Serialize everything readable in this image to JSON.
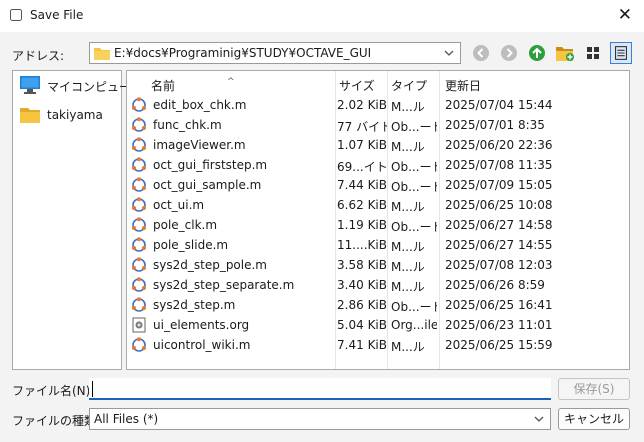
{
  "window": {
    "title": "Save File",
    "close_glyph": "✕"
  },
  "address": {
    "label": "アドレス:",
    "path": "E:¥docs¥Programinig¥STUDY¥OCTAVE_GUI"
  },
  "toolbar": {
    "buttons": [
      "back-icon",
      "forward-icon",
      "parent-folder-icon",
      "new-folder-icon",
      "icon-view-icon",
      "detail-view-icon"
    ]
  },
  "sidebar": {
    "items": [
      {
        "label": "マイコンピュータ",
        "icon": "computer-icon"
      },
      {
        "label": "takiyama",
        "icon": "folder-icon"
      }
    ]
  },
  "file_list": {
    "columns": [
      "名前",
      "サイズ",
      "タイプ",
      "更新日"
    ],
    "rows": [
      {
        "name": "edit_box_chk.m",
        "size": "2.02 KiB",
        "type": "M...ル",
        "date": "2025/07/04 15:44",
        "icon": "octave-file-icon"
      },
      {
        "name": "func_chk.m",
        "size": "77 バイト",
        "type": "Ob...ード",
        "date": "2025/07/01 8:35",
        "icon": "octave-file-icon"
      },
      {
        "name": "imageViewer.m",
        "size": "1.07 KiB",
        "type": "M...ル",
        "date": "2025/06/20 22:36",
        "icon": "octave-file-icon"
      },
      {
        "name": "oct_gui_firststep.m",
        "size": "69...イト",
        "type": "Ob...ード",
        "date": "2025/07/08 11:35",
        "icon": "octave-file-icon"
      },
      {
        "name": "oct_gui_sample.m",
        "size": "7.44 KiB",
        "type": "Ob...ード",
        "date": "2025/07/09 15:05",
        "icon": "octave-file-icon"
      },
      {
        "name": "oct_ui.m",
        "size": "6.62 KiB",
        "type": "M...ル",
        "date": "2025/06/25 10:08",
        "icon": "octave-file-icon"
      },
      {
        "name": "pole_clk.m",
        "size": "1.19 KiB",
        "type": "Ob...ード",
        "date": "2025/06/27 14:58",
        "icon": "octave-file-icon"
      },
      {
        "name": "pole_slide.m",
        "size": "11....KiB",
        "type": "M...ル",
        "date": "2025/06/27 14:55",
        "icon": "octave-file-icon"
      },
      {
        "name": "sys2d_step_pole.m",
        "size": "3.58 KiB",
        "type": "M...ル",
        "date": "2025/07/08 12:03",
        "icon": "octave-file-icon"
      },
      {
        "name": "sys2d_step_separate.m",
        "size": "3.40 KiB",
        "type": "M...ル",
        "date": "2025/06/26 8:59",
        "icon": "octave-file-icon"
      },
      {
        "name": "sys2d_step.m",
        "size": "2.86 KiB",
        "type": "Ob...ード",
        "date": "2025/06/25 16:41",
        "icon": "octave-file-icon"
      },
      {
        "name": "ui_elements.org",
        "size": "5.04 KiB",
        "type": "Org...ile",
        "date": "2025/06/23 11:01",
        "icon": "org-file-icon"
      },
      {
        "name": "uicontrol_wiki.m",
        "size": "7.41 KiB",
        "type": "M...ル",
        "date": "2025/06/25 15:59",
        "icon": "octave-file-icon"
      }
    ]
  },
  "filename": {
    "label": "ファイル名(N):",
    "value": "",
    "placeholder": ""
  },
  "filetype": {
    "label": "ファイルの種類:",
    "value": "All Files (*)"
  },
  "buttons": {
    "save": "保存(S)",
    "cancel": "キャンセル"
  },
  "colors": {
    "accent": "#1f5fbf",
    "folder": "#f5c542",
    "octave_orange": "#e8792d",
    "octave_blue": "#3a6fc4"
  }
}
